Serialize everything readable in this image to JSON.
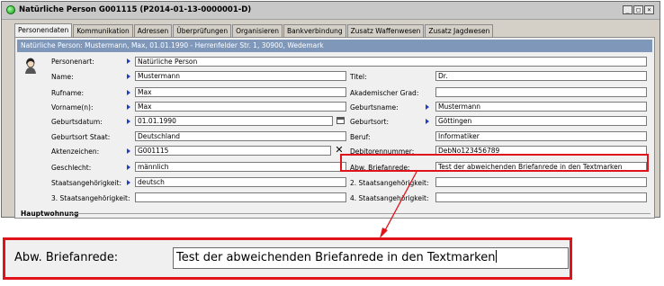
{
  "window": {
    "title": "Natürliche Person G001115 (P2014-01-13-0000001-D)",
    "controls": [
      "_",
      "□",
      "×"
    ]
  },
  "tabs": [
    {
      "label": "Personendaten",
      "active": true
    },
    {
      "label": "Kommunikation",
      "active": false
    },
    {
      "label": "Adressen",
      "active": false
    },
    {
      "label": "Überprüfungen",
      "active": false
    },
    {
      "label": "Organisieren",
      "active": false
    },
    {
      "label": "Bankverbindung",
      "active": false
    },
    {
      "label": "Zusatz Waffenwesen",
      "active": false
    },
    {
      "label": "Zusatz Jagdwesen",
      "active": false
    }
  ],
  "summary": "Natürliche Person: Mustermann, Max, 01.01.1990 - Herrenfelder Str. 1, 30900, Wedemark",
  "left_fields": [
    {
      "label": "Personenart:",
      "value": ""
    },
    {
      "label": "Name:",
      "value": "Mustermann"
    },
    {
      "label": "Rufname:",
      "value": "Max"
    },
    {
      "label": "Vorname(n):",
      "value": "Max"
    },
    {
      "label": "Geburtsdatum:",
      "value": "01.01.1990"
    },
    {
      "label": "Geburtsort Staat:",
      "value": "Deutschland"
    },
    {
      "label": "Aktenzeichen:",
      "value": "G001115"
    },
    {
      "label": "Geschlecht:",
      "value": "männlich"
    },
    {
      "label": "Staatsangehörigkeit:",
      "value": "deutsch"
    },
    {
      "label": "3. Staatsangehörigkeit:",
      "value": ""
    }
  ],
  "personenart_value": "Natürliche Person",
  "right_fields": [
    {
      "label": "Titel:",
      "value": "Dr."
    },
    {
      "label": "Akademischer Grad:",
      "value": ""
    },
    {
      "label": "Geburtsname:",
      "value": "Mustermann"
    },
    {
      "label": "Geburtsort:",
      "value": "Göttingen"
    },
    {
      "label": "Beruf:",
      "value": "Informatiker"
    },
    {
      "label": "Debitorennummer:",
      "value": "DebNo123456789"
    },
    {
      "label": "Abw. Briefanrede:",
      "value": "Test der abweichenden Briefanrede in den Textmarken"
    },
    {
      "label": "2. Staatsangehörigkeit:",
      "value": ""
    },
    {
      "label": "4. Staatsangehörigkeit:",
      "value": ""
    }
  ],
  "section": {
    "title": "Hauptwohnung"
  },
  "zoom": {
    "label": "Abw. Briefanrede:",
    "value": "Test der abweichenden Briefanrede in den Textmarken"
  },
  "icons": {
    "app": "status-dot-icon",
    "avatar": "person-avatar-icon",
    "required": "required-arrow-icon",
    "calendar": "calendar-icon",
    "clear": "clear-x-icon"
  },
  "colors": {
    "highlight": "#e0121a",
    "summary_bar": "#7f97b9",
    "required_arrow": "#1f3fbf"
  }
}
